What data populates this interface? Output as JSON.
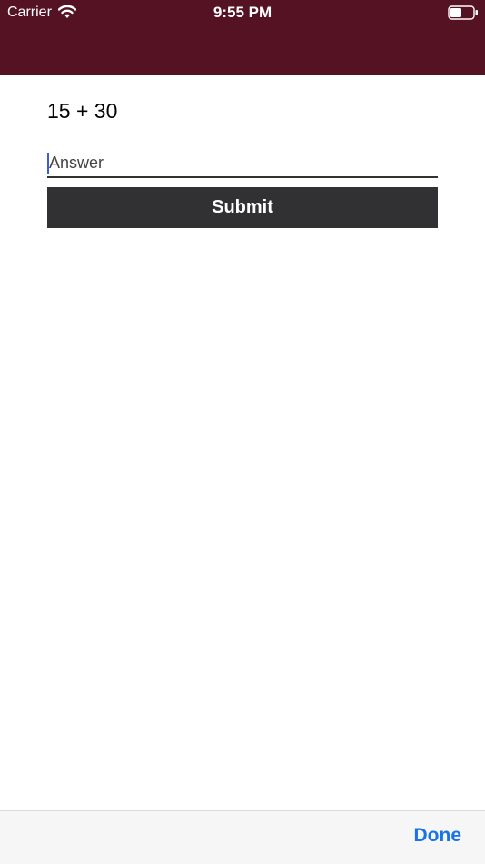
{
  "status_bar": {
    "carrier": "Carrier",
    "time": "9:55 PM",
    "wifi_icon": "wifi-icon",
    "battery_icon": "battery-icon"
  },
  "header": {
    "color": "#541223"
  },
  "quiz": {
    "question": "15 + 30",
    "answer_placeholder": "Answer",
    "answer_value": "",
    "submit_label": "Submit"
  },
  "keyboard_toolbar": {
    "done_label": "Done",
    "done_color": "#1773e6"
  }
}
